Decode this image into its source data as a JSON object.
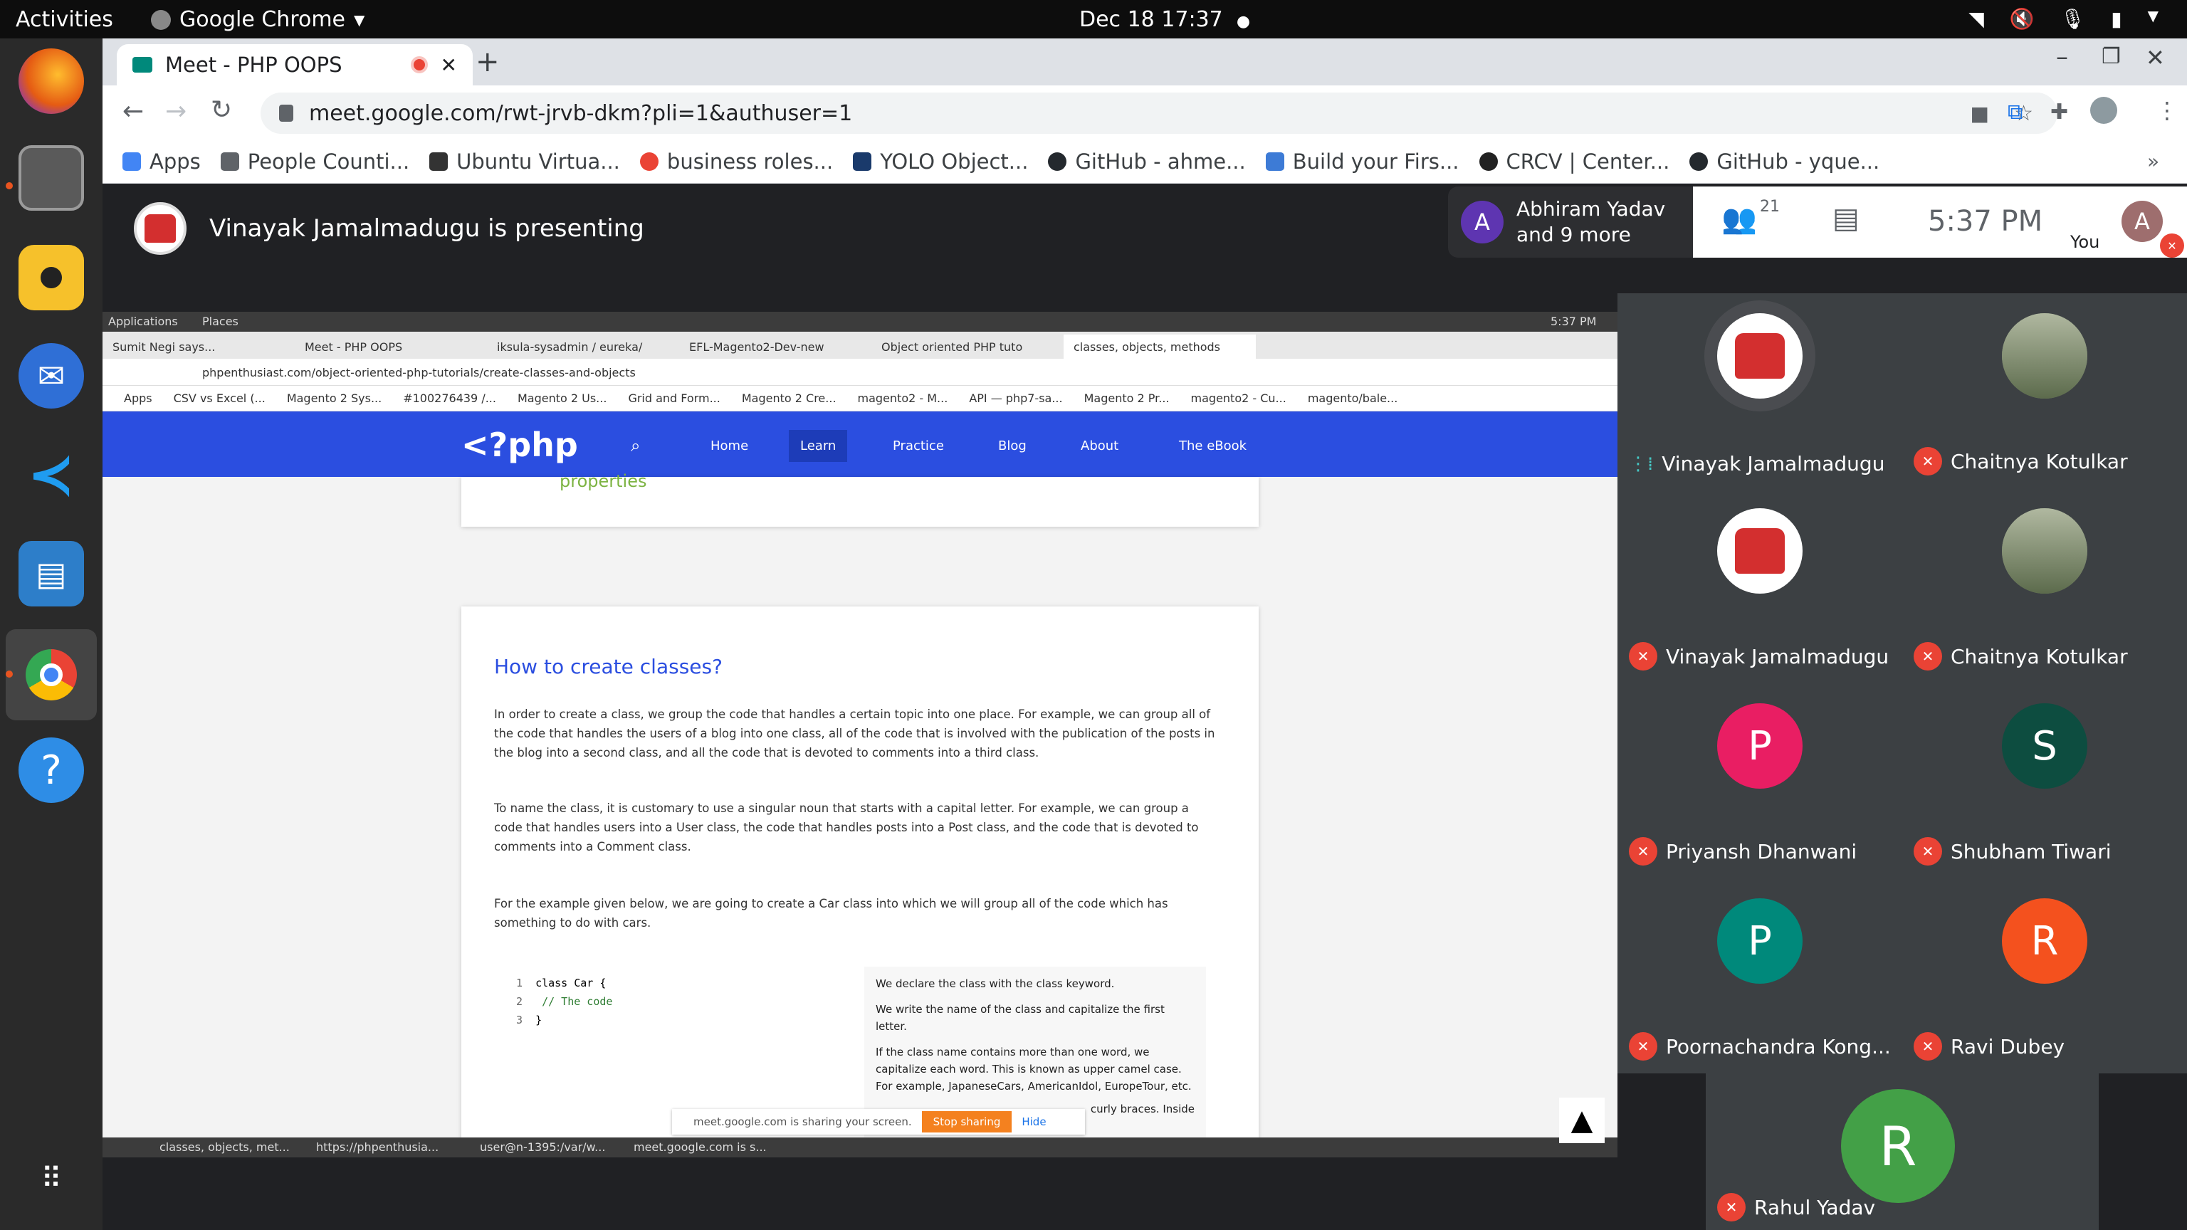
{
  "topbar": {
    "activities": "Activities",
    "app": "Google Chrome",
    "clock": "Dec 18  17:37"
  },
  "chrome": {
    "tab_title": "Meet - PHP OOPS",
    "url": "meet.google.com/rwt-jrvb-dkm?pli=1&authuser=1",
    "bookmarks": [
      "Apps",
      "People Counti...",
      "Ubuntu Virtua...",
      "business roles...",
      "YOLO Object...",
      "GitHub - ahme...",
      "Build your Firs...",
      "CRCV | Center...",
      "GitHub - yque..."
    ],
    "bookmark_colors": [
      "#4285f4",
      "#5f6368",
      "#333333",
      "#ea4335",
      "#1a3a6b",
      "#24292e",
      "#3d7bd6",
      "#222222",
      "#24292e"
    ]
  },
  "meet": {
    "presenting": "Vinayak Jamalmadugu is presenting",
    "others_name": "Abhiram Yadav",
    "others_more": "and 9 more",
    "others_initial": "A",
    "people_count": "21",
    "time": "5:37  PM",
    "self_initial": "A",
    "self_label": "You",
    "tiles": [
      {
        "name": "Vinayak Jamalmadugu",
        "avatar": "logo",
        "color": "#ffffff",
        "speaking": true
      },
      {
        "name": "Chaitnya Kotulkar",
        "avatar": "photo",
        "color": "#7a8a6a"
      },
      {
        "name": "Vinayak Jamalmadugu",
        "avatar": "logo",
        "color": "#ffffff"
      },
      {
        "name": "Chaitnya Kotulkar",
        "avatar": "photo",
        "color": "#7a8a6a"
      },
      {
        "name": "Priyansh Dhanwani",
        "avatar": "P",
        "color": "#e91e63"
      },
      {
        "name": "Shubham Tiwari",
        "avatar": "S",
        "color": "#0d4d40"
      },
      {
        "name": "Poornachandra Kong...",
        "avatar": "P",
        "color": "#00897b"
      },
      {
        "name": "Ravi Dubey",
        "avatar": "R",
        "color": "#f4511e"
      }
    ],
    "bottom_tile": {
      "name": "Rahul Yadav",
      "avatar": "R",
      "color": "#43a047"
    }
  },
  "shared": {
    "sys": {
      "applications": "Applications",
      "places": "Places",
      "time": "5:37 PM"
    },
    "tabs": [
      "Sumit Negi says...",
      "Meet - PHP OOPS",
      "iksula-sysadmin / eureka/",
      "EFL-Magento2-Dev-new",
      "Object oriented PHP tuto",
      "classes, objects, methods"
    ],
    "url": "phpenthusiast.com/object-oriented-php-tutorials/create-classes-and-objects",
    "bookmarks": [
      "Apps",
      "CSV vs Excel (...",
      "Magento 2 Sys...",
      "#100276439 /...",
      "Magento 2 Us...",
      "Grid and Form...",
      "Magento 2 Cre...",
      "magento2 - M...",
      "API — php7-sa...",
      "Magento 2 Pr...",
      "magento2 - Cu...",
      "magento/bale..."
    ],
    "nav": {
      "logo": "<?php",
      "items": [
        "Home",
        "Learn",
        "Practice",
        "Blog",
        "About",
        "The eBook"
      ]
    },
    "prev_fragment": "properties",
    "heading": "How to create classes?",
    "p1": "In order to create a class, we group the code that handles a certain topic into one place. For example, we can group all of the code that handles the users of a blog into one class, all of the code that is involved with the publication of the posts in the blog into a second class, and all the code that is devoted to comments into a third class.",
    "p2": "To name the class, it is customary to use a singular noun that starts with a capital letter. For example, we can group a code that handles users into a User class, the code that handles posts into a Post class, and the code that is devoted to comments into a Comment class.",
    "p3": "For the example given below, we are going to create a Car class into which we will group all of the code which has something to do with cars.",
    "code": [
      {
        "n": "1",
        "t": "class Car {"
      },
      {
        "n": "2",
        "t": "  // The code"
      },
      {
        "n": "3",
        "t": "}"
      }
    ],
    "note1": "We declare the class with the class keyword.",
    "note2": "We write the name of the class and capitalize the first letter.",
    "note3": "If the class name contains more than one word, we capitalize each word. This is known as upper camel case. For example, JapaneseCars, AmericanIdol, EuropeTour, etc.",
    "note4": "curly braces. Inside",
    "share_text": "meet.google.com is sharing your screen.",
    "stop": "Stop sharing",
    "hide": "Hide",
    "taskbar": [
      "classes, objects, met...",
      "https://phpenthusia...",
      "user@n-1395:/var/w...",
      "meet.google.com is s..."
    ]
  }
}
